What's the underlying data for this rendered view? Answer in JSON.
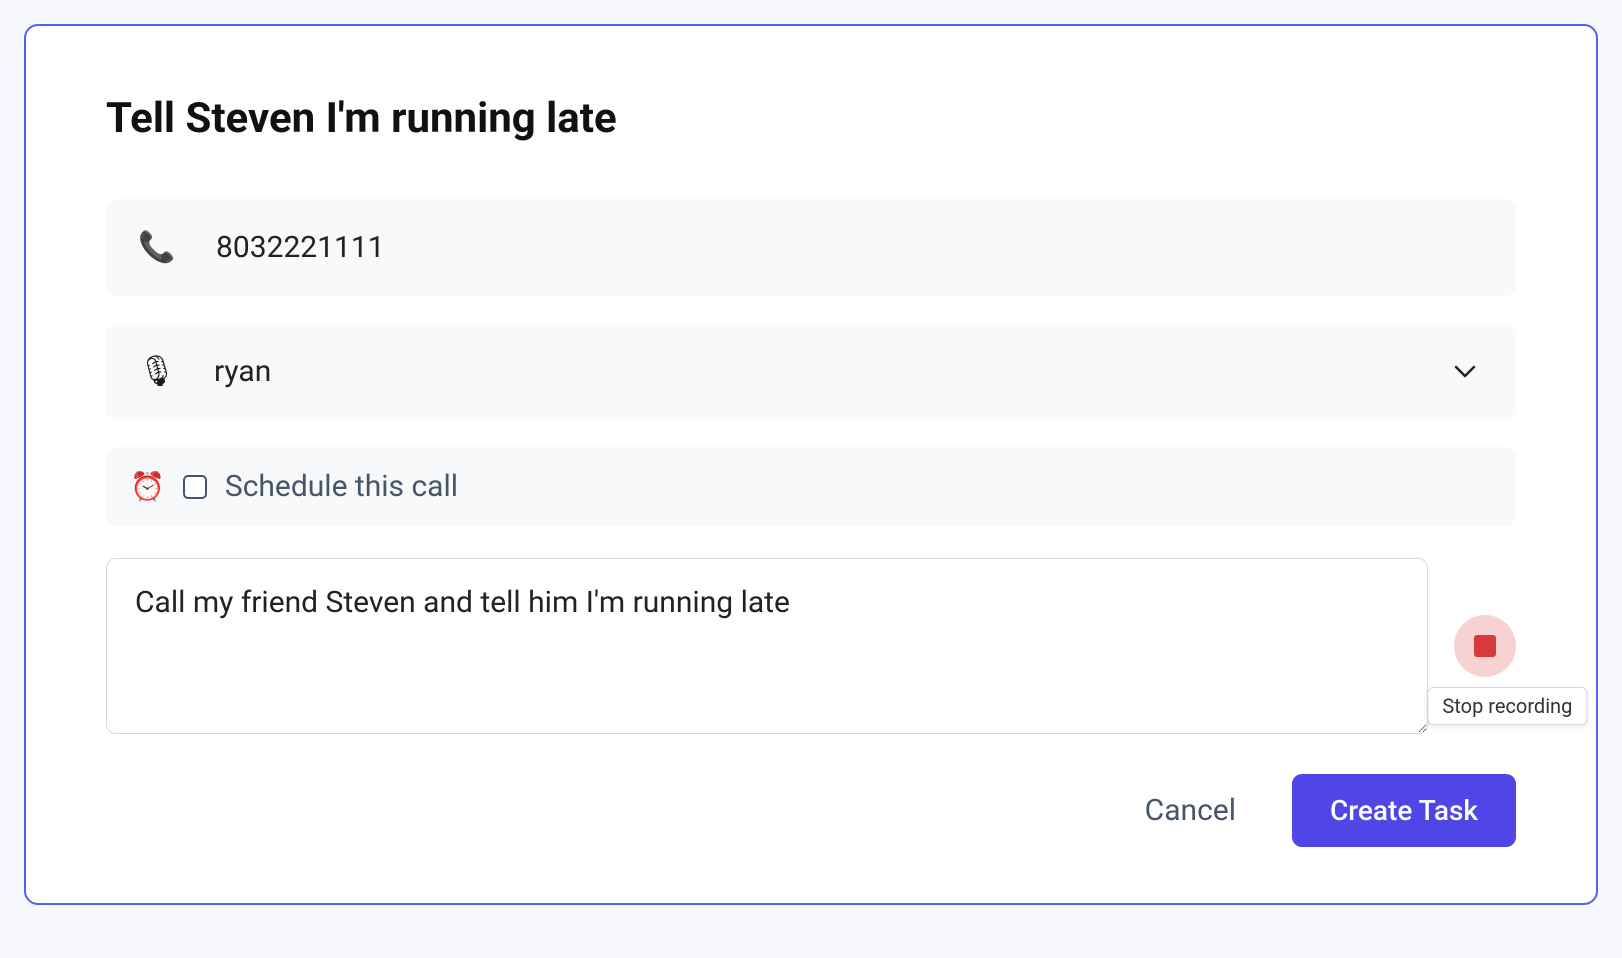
{
  "task": {
    "title": "Tell Steven I'm running late",
    "phone": {
      "icon": "📞",
      "value": "8032221111"
    },
    "voice": {
      "icon": "🎙",
      "selected": "ryan"
    },
    "schedule": {
      "icon": "⏰",
      "checked": false,
      "label": "Schedule this call"
    },
    "notes": "Call my friend Steven and tell him I'm running late",
    "record": {
      "tooltip": "Stop recording"
    }
  },
  "actions": {
    "cancel": "Cancel",
    "create": "Create Task"
  }
}
